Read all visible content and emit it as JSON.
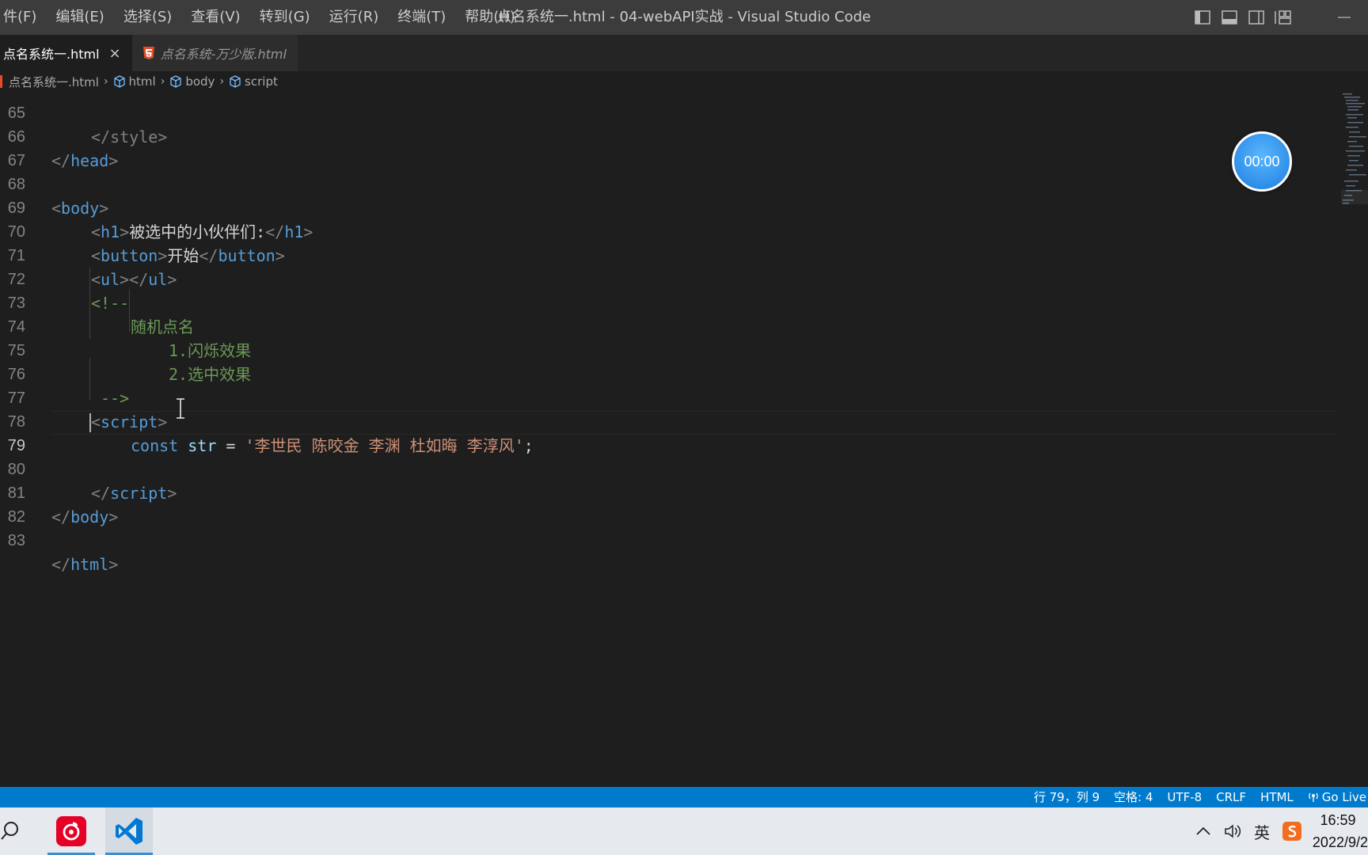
{
  "menu": [
    "件(F)",
    "编辑(E)",
    "选择(S)",
    "查看(V)",
    "转到(G)",
    "运行(R)",
    "终端(T)",
    "帮助(H)"
  ],
  "window_title": "点名系统一.html - 04-webAPI实战 - Visual Studio Code",
  "tabs": [
    {
      "label": "点名系统一.html",
      "active": true,
      "close": "×"
    },
    {
      "label": "点名系统-万少版.html",
      "active": false
    }
  ],
  "breadcrumb": {
    "file": "点名系统一.html",
    "parts": [
      "html",
      "body",
      "script"
    ]
  },
  "code_lines": {
    "l65": {
      "num": "65",
      "text": "</style>"
    },
    "l66": {
      "num": "66",
      "open": "</",
      "tag": "head",
      "close": ">"
    },
    "l67": {
      "num": "67"
    },
    "l68": {
      "num": "68",
      "open": "<",
      "tag": "body",
      "close": ">"
    },
    "l69": {
      "num": "69",
      "tag": "h1",
      "text": "被选中的小伙伴们:"
    },
    "l70": {
      "num": "70",
      "tag": "button",
      "text": "开始"
    },
    "l71": {
      "num": "71",
      "tag": "ul"
    },
    "l72": {
      "num": "72",
      "text": "<!--"
    },
    "l73": {
      "num": "73",
      "text": "随机点名"
    },
    "l74": {
      "num": "74",
      "text": "1.闪烁效果"
    },
    "l75": {
      "num": "75",
      "text": "2.选中效果"
    },
    "l76": {
      "num": "76",
      "text": "-->"
    },
    "l77": {
      "num": "77",
      "tag": "script"
    },
    "l78": {
      "num": "78",
      "kw": "const",
      "var": "str",
      "op": " = ",
      "str": "'李世民 陈咬金 李渊 杜如晦 李淳风'",
      "end": ";"
    },
    "l79": {
      "num": "79"
    },
    "l80": {
      "num": "80",
      "tag": "script"
    },
    "l81": {
      "num": "81",
      "tag": "body"
    },
    "l82": {
      "num": "82"
    },
    "l83": {
      "num": "83",
      "tag": "html"
    }
  },
  "timer": "00:00",
  "status": {
    "position": "行 79，列 9",
    "spaces": "空格: 4",
    "encoding": "UTF-8",
    "eol": "CRLF",
    "language": "HTML",
    "golive": "Go Live"
  },
  "taskbar": {
    "ime": "英",
    "time": "16:59",
    "date": "2022/9/2"
  },
  "colors": {
    "accent": "#007acc",
    "tag": "#569cd6",
    "comment": "#6a9955",
    "string": "#ce9178"
  }
}
